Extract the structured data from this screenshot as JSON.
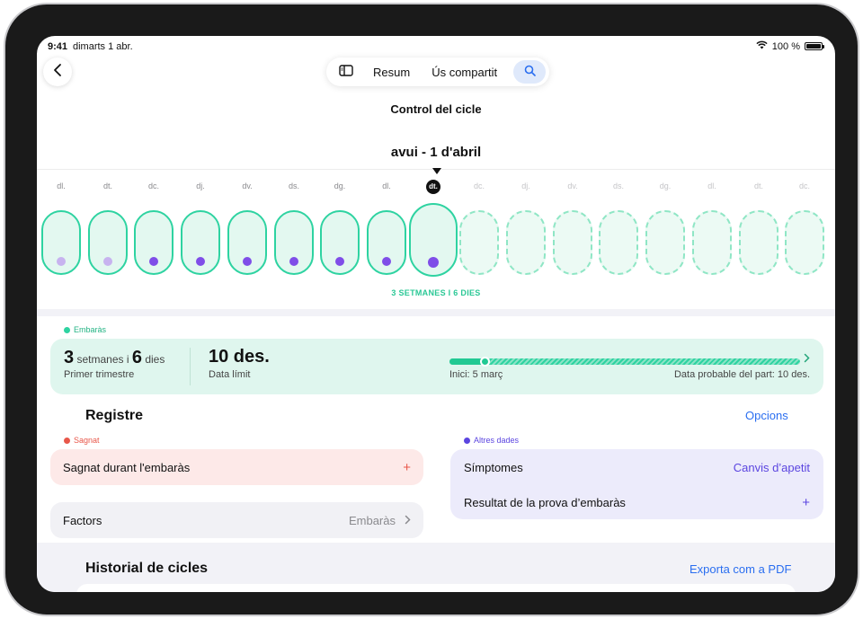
{
  "status": {
    "time": "9:41",
    "date": "dimarts 1 abr.",
    "battery": "100 %"
  },
  "toolbar": {
    "summary": "Resum",
    "sharing": "Ús compartit"
  },
  "page_title": "Control del cicle",
  "date_title": "avui - 1 d'abril",
  "days": [
    {
      "label": "dl.",
      "state": "past",
      "dot": "light"
    },
    {
      "label": "dt.",
      "state": "past",
      "dot": "light"
    },
    {
      "label": "dc.",
      "state": "past",
      "dot": "dark"
    },
    {
      "label": "dj.",
      "state": "past",
      "dot": "dark"
    },
    {
      "label": "dv.",
      "state": "past",
      "dot": "dark"
    },
    {
      "label": "ds.",
      "state": "past",
      "dot": "dark"
    },
    {
      "label": "dg.",
      "state": "past",
      "dot": "dark"
    },
    {
      "label": "dl.",
      "state": "past",
      "dot": "dark"
    },
    {
      "label": "dt.",
      "state": "today",
      "dot": "dark"
    },
    {
      "label": "dc.",
      "state": "future",
      "dot": "none"
    },
    {
      "label": "dj.",
      "state": "future",
      "dot": "none"
    },
    {
      "label": "dv.",
      "state": "future",
      "dot": "none"
    },
    {
      "label": "ds.",
      "state": "future",
      "dot": "none"
    },
    {
      "label": "dg.",
      "state": "future",
      "dot": "none"
    },
    {
      "label": "dl.",
      "state": "future",
      "dot": "none"
    },
    {
      "label": "dt.",
      "state": "future",
      "dot": "none"
    },
    {
      "label": "dc.",
      "state": "future",
      "dot": "none"
    }
  ],
  "weeks_caption": "3 SETMANES I 6 DIES",
  "pregnancy": {
    "tag": "Embaràs",
    "weeks_num": "3",
    "weeks_word": "setmanes i",
    "days_num": "6",
    "days_word": "dies",
    "trimester": "Primer trimestre",
    "due_value": "10 des.",
    "due_label": "Data límit",
    "progress_fraction": 0.1,
    "start_label": "Inici: 5 març",
    "due_probable": "Data probable del part: 10 des."
  },
  "registre": {
    "title": "Registre",
    "options": "Opcions",
    "bleeding_tag": "Sagnat",
    "bleeding_row": "Sagnat durant l'embaràs",
    "bleeding_value": "+",
    "factors_row": "Factors",
    "factors_value": "Embaràs",
    "other_tag": "Altres dades",
    "symptoms_row": "Símptomes",
    "symptoms_value": "Canvis d’apetit",
    "test_row": "Resultat de la prova d’embaràs",
    "test_value": "+"
  },
  "history": {
    "title": "Historial de cicles",
    "export": "Exporta com a PDF"
  },
  "colors": {
    "accent_green": "#2ed3a1",
    "accent_purple": "#7f4ee8",
    "bleeding_red": "#e8574a",
    "link_blue": "#2a6ef0"
  }
}
